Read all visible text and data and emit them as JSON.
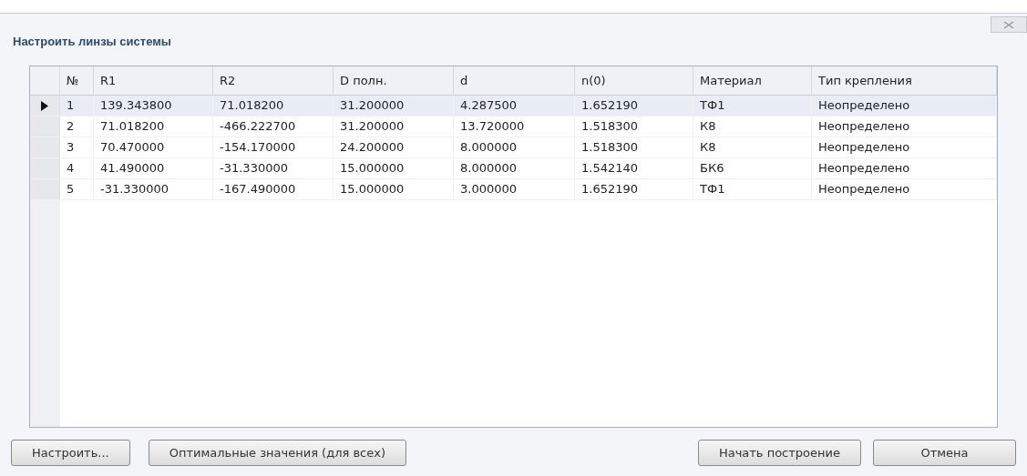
{
  "window": {
    "title": "Настроить линзы системы"
  },
  "table": {
    "columns": [
      "№",
      "R1",
      "R2",
      "D полн.",
      "d",
      "n(0)",
      "Материал",
      "Тип крепления"
    ],
    "rows": [
      {
        "selected": true,
        "cells": [
          "1",
          "139.343800",
          "71.018200",
          "31.200000",
          "4.287500",
          "1.652190",
          "ТФ1",
          "Неопределено"
        ]
      },
      {
        "selected": false,
        "cells": [
          "2",
          "71.018200",
          "-466.222700",
          "31.200000",
          "13.720000",
          "1.518300",
          "К8",
          "Неопределено"
        ]
      },
      {
        "selected": false,
        "cells": [
          "3",
          "70.470000",
          "-154.170000",
          "24.200000",
          "8.000000",
          "1.518300",
          "К8",
          "Неопределено"
        ]
      },
      {
        "selected": false,
        "cells": [
          "4",
          "41.490000",
          "-31.330000",
          "15.000000",
          "8.000000",
          "1.542140",
          "БК6",
          "Неопределено"
        ]
      },
      {
        "selected": false,
        "cells": [
          "5",
          "-31.330000",
          "-167.490000",
          "15.000000",
          "3.000000",
          "1.652190",
          "ТФ1",
          "Неопределено"
        ]
      }
    ]
  },
  "buttons": {
    "left": [
      "Настроить...",
      "Оптимальные значения (для всех)"
    ],
    "right": [
      "Начать построение",
      "Отмена"
    ]
  }
}
